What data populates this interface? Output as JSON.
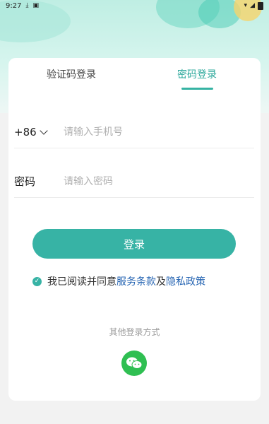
{
  "status_bar": {
    "time": "9:27",
    "icons": [
      "download-icon",
      "notification-icon",
      "wifi-icon",
      "signal-icon",
      "battery-icon"
    ]
  },
  "tabs": [
    {
      "label": "验证码登录",
      "active": false
    },
    {
      "label": "密码登录",
      "active": true
    }
  ],
  "phone_field": {
    "country_code": "+86",
    "placeholder": "请输入手机号"
  },
  "password_field": {
    "label": "密码",
    "placeholder": "请输入密码"
  },
  "login_button": {
    "label": "登录"
  },
  "agreement": {
    "prefix": "我已阅读并同意",
    "terms": "服务条款",
    "conjunction": "及",
    "privacy": "隐私政策",
    "checked": true
  },
  "other_login": {
    "title": "其他登录方式",
    "methods": [
      "wechat-icon"
    ]
  },
  "colors": {
    "accent": "#37b3a5",
    "link": "#2866b3",
    "wechat": "#2fbf52"
  }
}
